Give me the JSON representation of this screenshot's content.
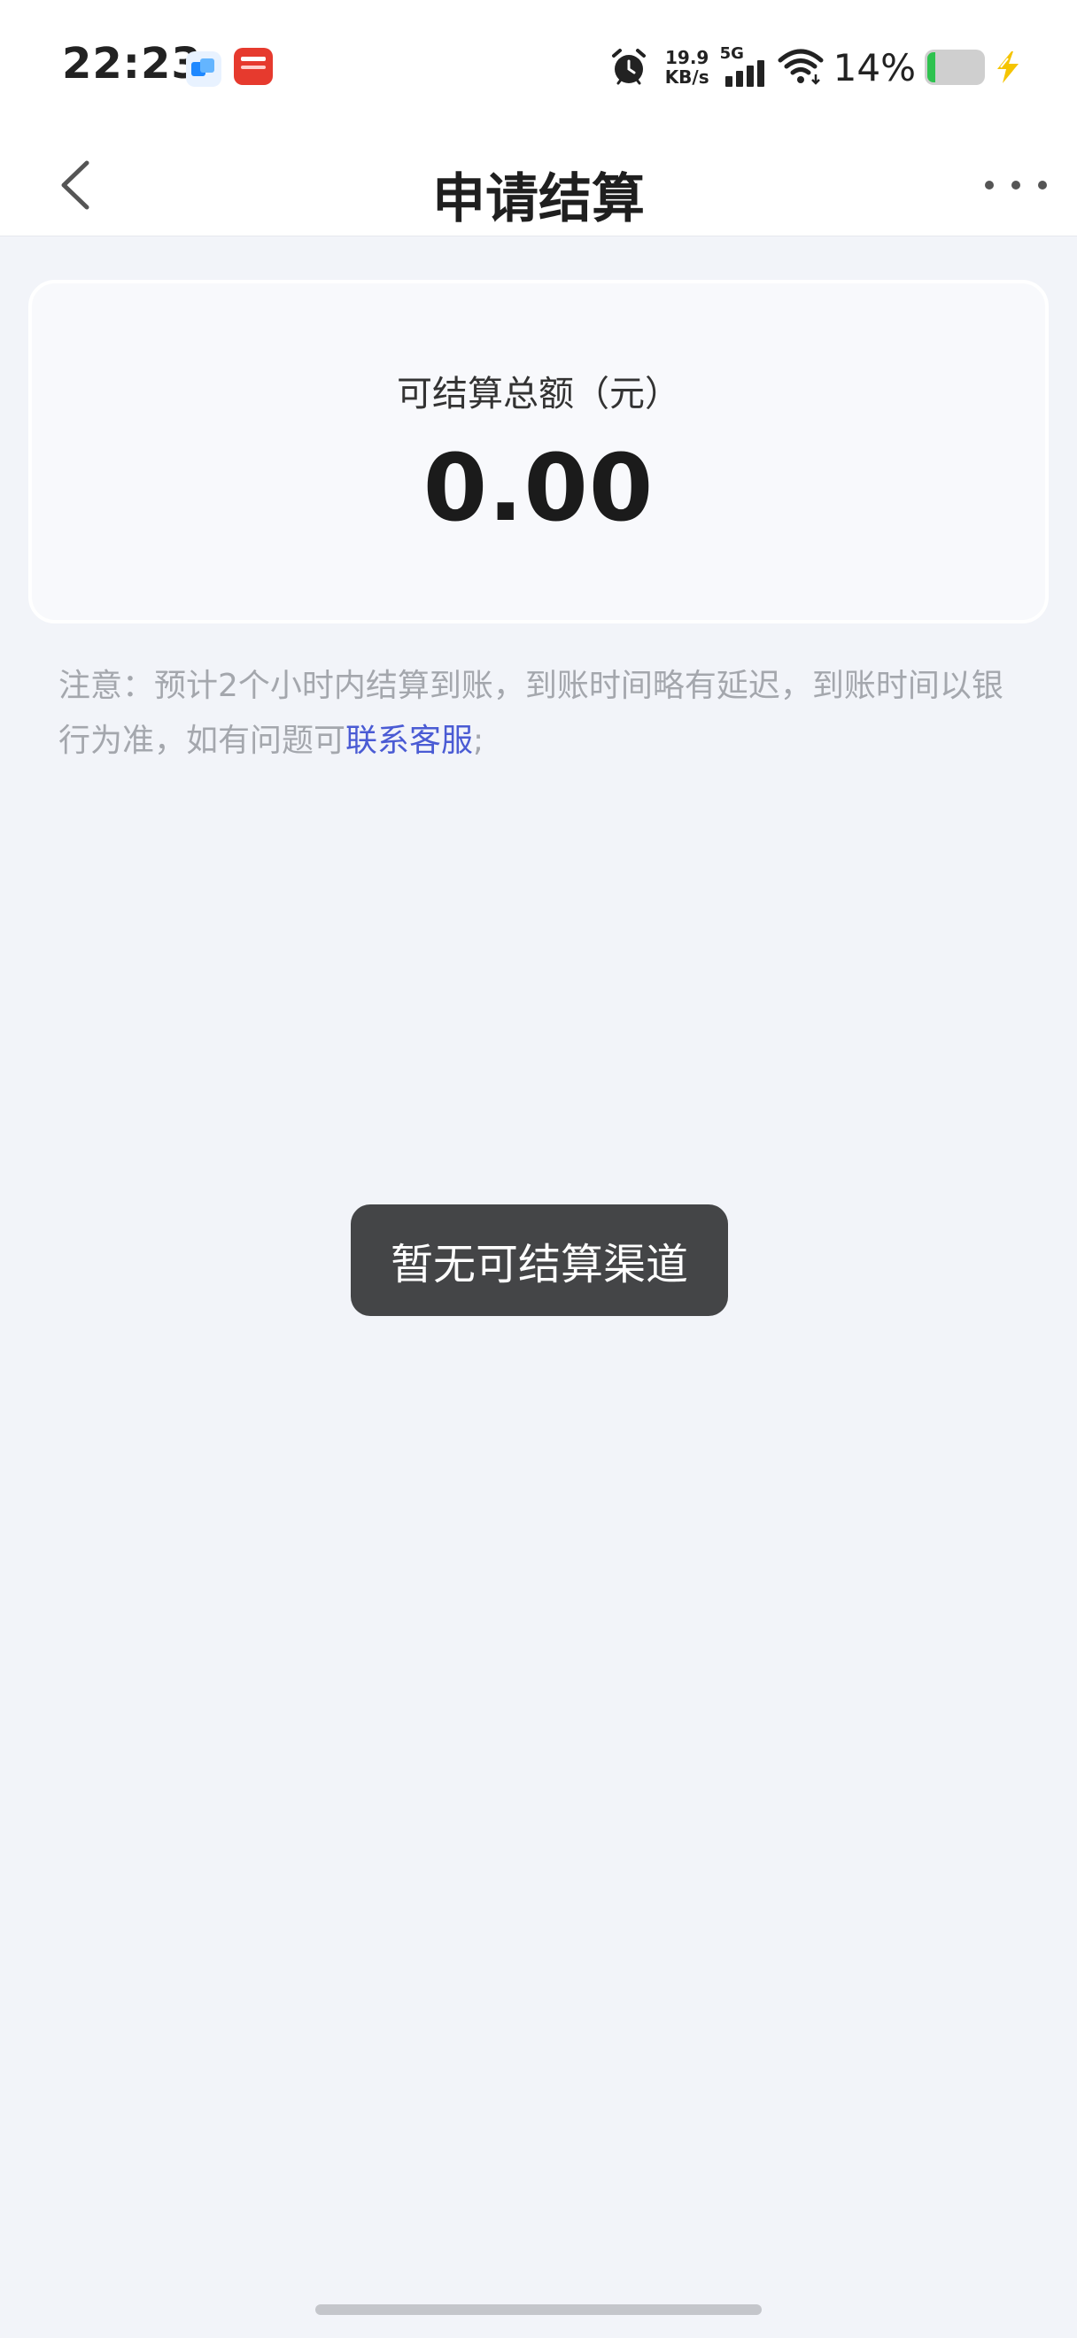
{
  "status_bar": {
    "time": "22:23",
    "net_speed_value": "19.9",
    "net_speed_unit": "KB/s",
    "network_type": "5G",
    "battery_percent": "14%",
    "battery_level": 0.14,
    "icons": [
      "app-notification-icon",
      "pay-app-notification-icon",
      "alarm-icon",
      "signal-icon",
      "wifi-icon",
      "battery-icon",
      "charging-bolt-icon"
    ]
  },
  "header": {
    "title": "申请结算",
    "back_icon": "chevron-left-icon",
    "more_icon": "more-dots-icon"
  },
  "summary": {
    "label": "可结算总额（元）",
    "amount": "0.00"
  },
  "notice": {
    "text": "注意：预计2个小时内结算到账，到账时间略有延迟，到账时间以银行为准，如有问题可",
    "link_text": "联系客服",
    "suffix": ";"
  },
  "toast": {
    "message": "暂无可结算渠道"
  },
  "colors": {
    "background": "#f2f4f9",
    "link": "#4a5bd4",
    "toast_bg": "#444547",
    "battery_green": "#2ec24f",
    "bolt_yellow": "#f5c400"
  }
}
